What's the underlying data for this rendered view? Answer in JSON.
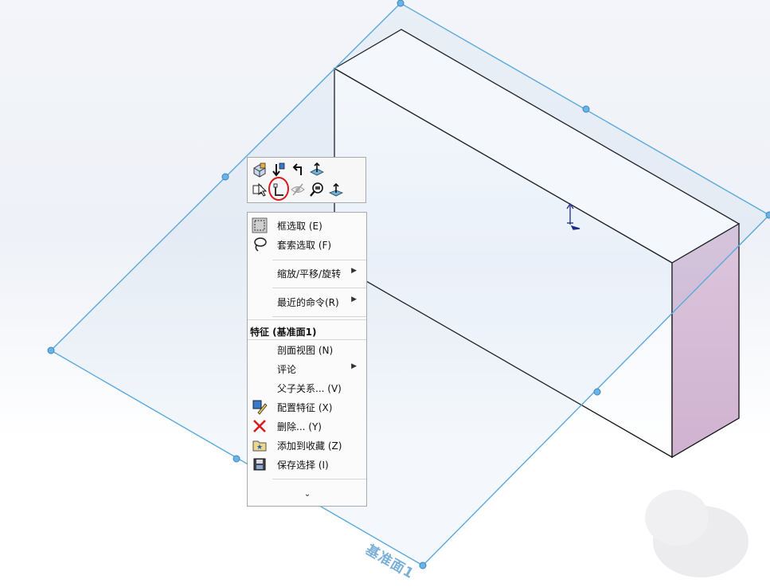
{
  "plane": {
    "label": "基准面1"
  },
  "context_toolbar": {
    "buttons": [
      "view-orientation-icon",
      "normal-to-icon",
      "rollback-icon",
      "plane-icon",
      "select-other-icon",
      "sketch-icon",
      "hide-icon",
      "zoom-to-selection-icon",
      "normal-to-plane-icon"
    ],
    "highlighted": "sketch-icon",
    "highlight_color": "#d71a1a"
  },
  "context_menu": {
    "items_top": [
      {
        "label": "框选取 (E)",
        "icon": "box-select-icon"
      },
      {
        "label": "套索选取 (F)",
        "icon": "lasso-select-icon"
      }
    ],
    "zoom_pan_rotate": "缩放/平移/旋转",
    "recent_commands": "最近的命令(R)",
    "section_title": "特征 (基准面1)",
    "items_feature": [
      {
        "label": "剖面视图 (N)",
        "icon": ""
      },
      {
        "label": "评论",
        "icon": "",
        "submenu": true
      },
      {
        "label": "父子关系... (V)",
        "icon": ""
      },
      {
        "label": "配置特征 (X)",
        "icon": "configure-feature-icon"
      },
      {
        "label": "删除... (Y)",
        "icon": "delete-icon"
      },
      {
        "label": "添加到收藏 (Z)",
        "icon": "add-favorite-icon"
      },
      {
        "label": "保存选择 (I)",
        "icon": "save-selection-icon"
      }
    ],
    "expand_glyph": "⌄"
  },
  "colors": {
    "plane_edge": "#5aa9dc",
    "box_side": "#d8bfd8",
    "accent_red": "#d71a1a"
  }
}
